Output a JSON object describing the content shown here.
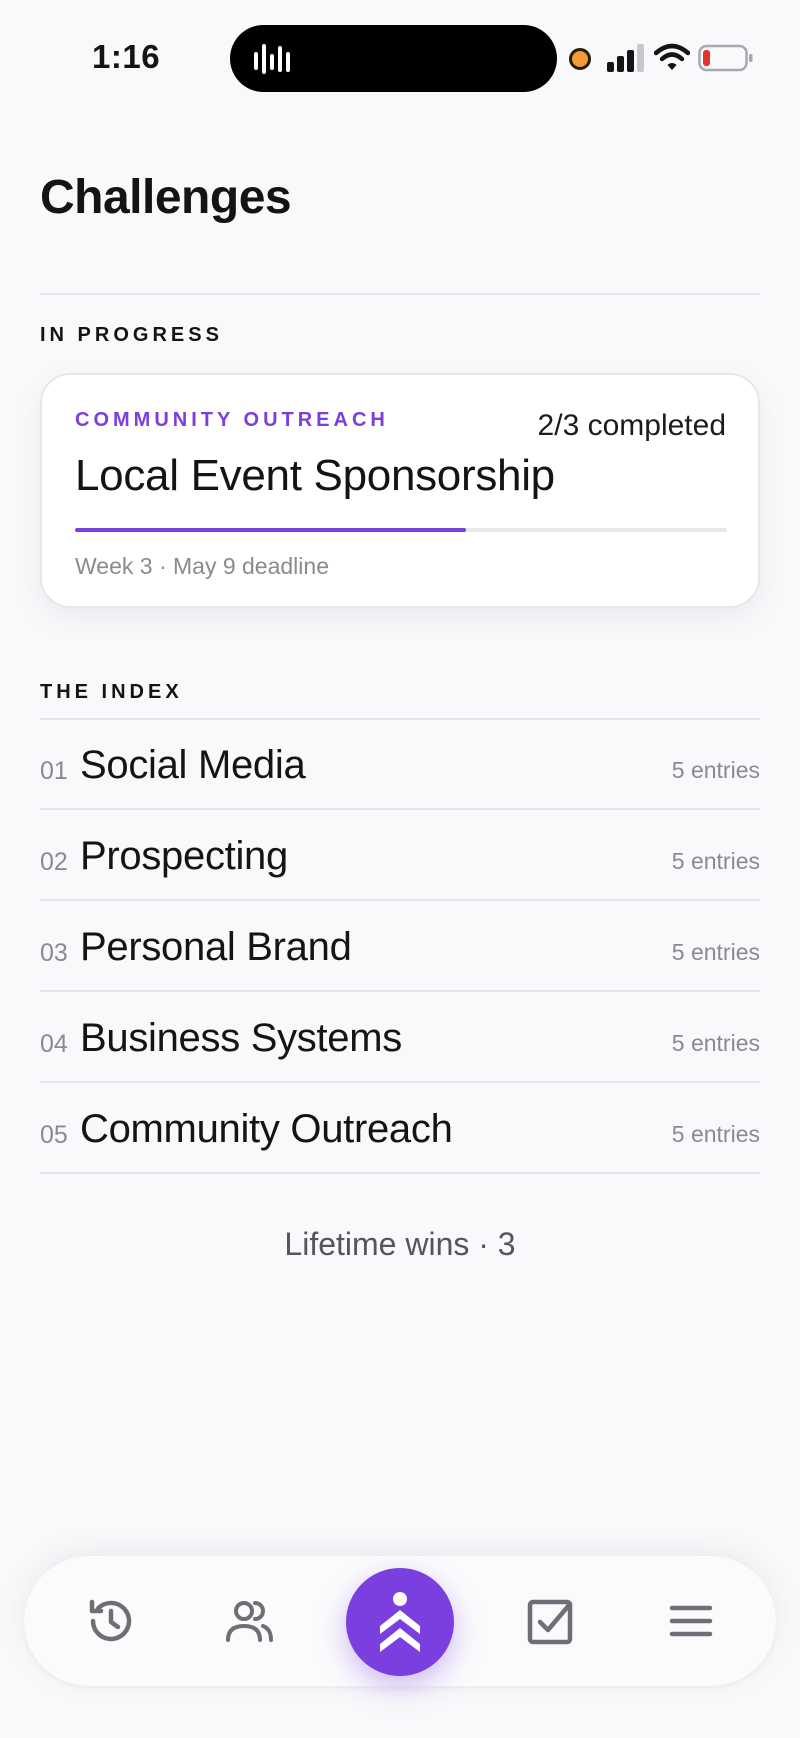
{
  "status_bar": {
    "time": "1:16"
  },
  "header": {
    "title": "Challenges"
  },
  "in_progress": {
    "section_label": "IN PROGRESS",
    "card": {
      "category": "COMMUNITY OUTREACH",
      "progress_text": "2/3 completed",
      "title": "Local Event Sponsorship",
      "progress_fraction": 0.6,
      "meta": "Week 3 · May 9 deadline"
    }
  },
  "index": {
    "section_label": "THE INDEX",
    "items": [
      {
        "num": "01",
        "name": "Social Media",
        "count": "5 entries"
      },
      {
        "num": "02",
        "name": "Prospecting",
        "count": "5 entries"
      },
      {
        "num": "03",
        "name": "Personal Brand",
        "count": "5 entries"
      },
      {
        "num": "04",
        "name": "Business Systems",
        "count": "5 entries"
      },
      {
        "num": "05",
        "name": "Community Outreach",
        "count": "5 entries"
      }
    ]
  },
  "footer": {
    "lifetime": "Lifetime wins · 3"
  },
  "tab_bar": {
    "tabs": [
      {
        "icon": "history-icon"
      },
      {
        "icon": "people-icon"
      },
      {
        "icon": "climber-icon",
        "active": true
      },
      {
        "icon": "checkbox-icon"
      },
      {
        "icon": "menu-icon"
      }
    ]
  },
  "colors": {
    "accent": "#7b3fe0",
    "background": "#f8f9fb",
    "muted_text": "#8a8a90",
    "battery_low": "#e5322d",
    "recording_dot": "#f29b38"
  }
}
